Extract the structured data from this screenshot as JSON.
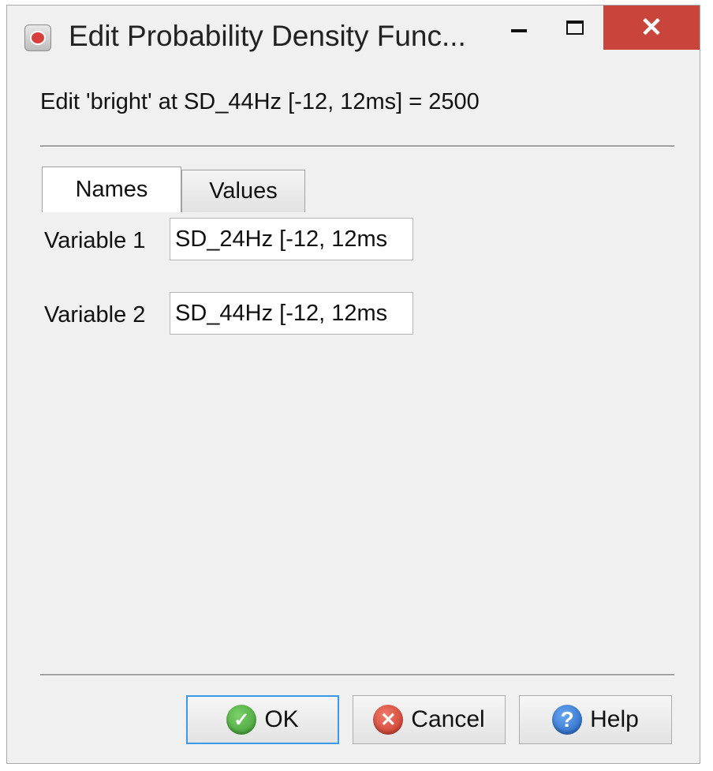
{
  "window": {
    "title": "Edit Probability Density Func...",
    "controls": {
      "close_glyph": "✕"
    }
  },
  "header": {
    "text": "Edit 'bright' at SD_44Hz [-12, 12ms] = 2500"
  },
  "tabs": [
    {
      "label": "Names",
      "active": true
    },
    {
      "label": "Values",
      "active": false
    }
  ],
  "fields": [
    {
      "label": "Variable 1",
      "value": "SD_24Hz [-12, 12ms"
    },
    {
      "label": "Variable 2",
      "value": "SD_44Hz [-12, 12ms"
    }
  ],
  "buttons": {
    "ok": {
      "label": "OK",
      "icon": "check-icon",
      "glyph": "✓"
    },
    "cancel": {
      "label": "Cancel",
      "icon": "x-icon",
      "glyph": "✕"
    },
    "help": {
      "label": "Help",
      "icon": "question-icon",
      "glyph": "?"
    }
  },
  "colors": {
    "close_button": "#c9453c",
    "default_button_border": "#3a9ae8",
    "background": "#f0f0f0"
  }
}
